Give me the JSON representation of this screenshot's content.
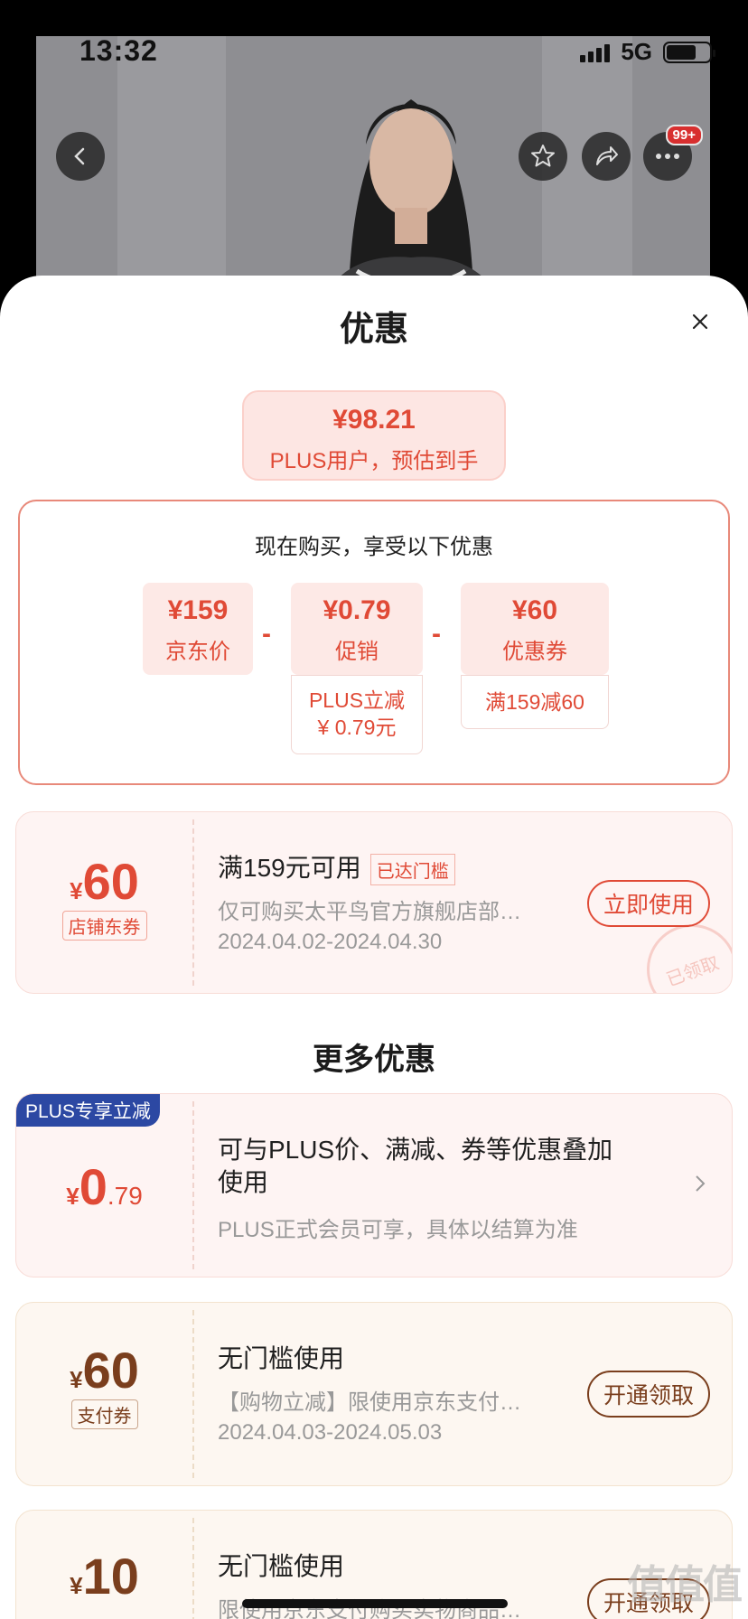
{
  "status_bar": {
    "time": "13:32",
    "network": "5G"
  },
  "header": {
    "cart_badge": "99+"
  },
  "sheet": {
    "title": "优惠"
  },
  "estimate": {
    "price": "¥98.21",
    "label": "PLUS用户，预估到手"
  },
  "calc": {
    "title": "现在购买，享受以下优惠",
    "items": [
      {
        "value": "¥159",
        "label": "京东价"
      },
      {
        "value": "¥0.79",
        "label": "促销",
        "note_line1": "PLUS立减",
        "note_line2": "¥ 0.79元"
      },
      {
        "value": "¥60",
        "label": "优惠券",
        "note_line1": "满159减60"
      }
    ],
    "operator": "-"
  },
  "coupon_main": {
    "currency": "¥",
    "amount": "60",
    "tag": "店铺东券",
    "title": "满159元可用",
    "reached": "已达门槛",
    "desc": "仅可购买太平鸟官方旗舰店部…",
    "date": "2024.04.02-2024.04.30",
    "button": "立即使用",
    "stamp": "已领取"
  },
  "more_title": "更多优惠",
  "coupon_plus": {
    "ribbon": "PLUS专享立减",
    "currency": "¥",
    "amount_int": "0",
    "amount_dec": ".79",
    "title_line1": "可与PLUS价、满减、券等优惠叠加",
    "title_line2": "使用",
    "desc": "PLUS正式会员可享，具体以结算为准"
  },
  "coupon_pay": {
    "currency": "¥",
    "amount": "60",
    "tag": "支付券",
    "title": "无门槛使用",
    "desc": "【购物立减】限使用京东支付…",
    "date": "2024.04.03-2024.05.03",
    "button": "开通领取"
  },
  "coupon_pay2": {
    "currency": "¥",
    "amount": "10",
    "title": "无门槛使用",
    "desc": "限使用京东支付购买实物商品…",
    "button": "开通领取"
  },
  "watermark": "值值值",
  "colors": {
    "accent_red": "#e04a36",
    "gold_brown": "#7a3e1d",
    "plus_blue": "#2c48a3"
  }
}
